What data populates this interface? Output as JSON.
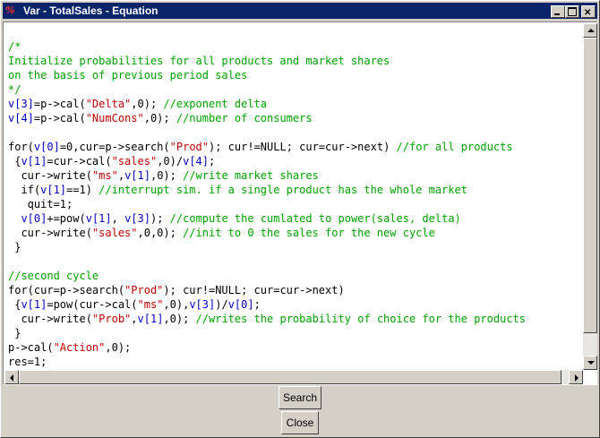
{
  "window": {
    "title": "Var - TotalSales - Equation",
    "icon_text": "%",
    "controls": [
      "minimize-icon",
      "maximize-icon",
      "close-icon"
    ]
  },
  "colors": {
    "titlebar": "#0a246a",
    "comment": "#00a000",
    "variable": "#0000c0",
    "string": "#c00000"
  },
  "editor": {
    "lines": [
      [
        {
          "t": "/*",
          "c": "comment"
        }
      ],
      [
        {
          "t": "Initialize probabilities for all products and market shares",
          "c": "comment"
        }
      ],
      [
        {
          "t": "on the basis of previous period sales",
          "c": "comment"
        }
      ],
      [
        {
          "t": "*/",
          "c": "comment"
        }
      ],
      [
        {
          "t": "v[3]",
          "c": "var"
        },
        {
          "t": "=p->cal(",
          "c": ""
        },
        {
          "t": "\"Delta\"",
          "c": "str"
        },
        {
          "t": ",0); ",
          "c": ""
        },
        {
          "t": "//exponent delta",
          "c": "comment"
        }
      ],
      [
        {
          "t": "v[4]",
          "c": "var"
        },
        {
          "t": "=p->cal(",
          "c": ""
        },
        {
          "t": "\"NumCons\"",
          "c": "str"
        },
        {
          "t": ",0); ",
          "c": ""
        },
        {
          "t": "//number of consumers",
          "c": "comment"
        }
      ],
      [
        {
          "t": "",
          "c": ""
        }
      ],
      [
        {
          "t": "for(",
          "c": ""
        },
        {
          "t": "v[0]",
          "c": "var"
        },
        {
          "t": "=0,cur=p->search(",
          "c": ""
        },
        {
          "t": "\"Prod\"",
          "c": "str"
        },
        {
          "t": "); cur!=NULL; cur=cur->next) ",
          "c": ""
        },
        {
          "t": "//for all products",
          "c": "comment"
        }
      ],
      [
        {
          "t": " {",
          "c": ""
        },
        {
          "t": "v[1]",
          "c": "var"
        },
        {
          "t": "=cur->cal(",
          "c": ""
        },
        {
          "t": "\"sales\"",
          "c": "str"
        },
        {
          "t": ",0)/",
          "c": ""
        },
        {
          "t": "v[4]",
          "c": "var"
        },
        {
          "t": ";",
          "c": ""
        }
      ],
      [
        {
          "t": "  cur->write(",
          "c": ""
        },
        {
          "t": "\"ms\"",
          "c": "str"
        },
        {
          "t": ",",
          "c": ""
        },
        {
          "t": "v[1]",
          "c": "var"
        },
        {
          "t": ",0); ",
          "c": ""
        },
        {
          "t": "//write market shares",
          "c": "comment"
        }
      ],
      [
        {
          "t": "  if(",
          "c": ""
        },
        {
          "t": "v[1]",
          "c": "var"
        },
        {
          "t": "==1) ",
          "c": ""
        },
        {
          "t": "//interrupt sim. if a single product has the whole market",
          "c": "comment"
        }
      ],
      [
        {
          "t": "   quit=1;",
          "c": ""
        }
      ],
      [
        {
          "t": "  ",
          "c": ""
        },
        {
          "t": "v[0]",
          "c": "var"
        },
        {
          "t": "+=pow(",
          "c": ""
        },
        {
          "t": "v[1]",
          "c": "var"
        },
        {
          "t": ", ",
          "c": ""
        },
        {
          "t": "v[3]",
          "c": "var"
        },
        {
          "t": "); ",
          "c": ""
        },
        {
          "t": "//compute the cumlated to power(sales, delta)",
          "c": "comment"
        }
      ],
      [
        {
          "t": "  cur->write(",
          "c": ""
        },
        {
          "t": "\"sales\"",
          "c": "str"
        },
        {
          "t": ",0,0); ",
          "c": ""
        },
        {
          "t": "//init to 0 the sales for the new cycle",
          "c": "comment"
        }
      ],
      [
        {
          "t": " }",
          "c": ""
        }
      ],
      [
        {
          "t": "",
          "c": ""
        }
      ],
      [
        {
          "t": "//second cycle",
          "c": "comment"
        }
      ],
      [
        {
          "t": "for(cur=p->search(",
          "c": ""
        },
        {
          "t": "\"Prod\"",
          "c": "str"
        },
        {
          "t": "); cur!=NULL; cur=cur->next)",
          "c": ""
        }
      ],
      [
        {
          "t": " {",
          "c": ""
        },
        {
          "t": "v[1]",
          "c": "var"
        },
        {
          "t": "=pow(cur->cal(",
          "c": ""
        },
        {
          "t": "\"ms\"",
          "c": "str"
        },
        {
          "t": ",0),",
          "c": ""
        },
        {
          "t": "v[3]",
          "c": "var"
        },
        {
          "t": ")/",
          "c": ""
        },
        {
          "t": "v[0]",
          "c": "var"
        },
        {
          "t": ";",
          "c": ""
        }
      ],
      [
        {
          "t": "  cur->write(",
          "c": ""
        },
        {
          "t": "\"Prob\"",
          "c": "str"
        },
        {
          "t": ",",
          "c": ""
        },
        {
          "t": "v[1]",
          "c": "var"
        },
        {
          "t": ",0); ",
          "c": ""
        },
        {
          "t": "//writes the probability of choice for the products",
          "c": "comment"
        }
      ],
      [
        {
          "t": " }",
          "c": ""
        }
      ],
      [
        {
          "t": "p->cal(",
          "c": ""
        },
        {
          "t": "\"Action\"",
          "c": "str"
        },
        {
          "t": ",0);",
          "c": ""
        }
      ],
      [
        {
          "t": "res=1;",
          "c": ""
        }
      ]
    ]
  },
  "scrollbars": {
    "vertical": [
      "up-arrow-icon",
      "down-arrow-icon"
    ],
    "horizontal": [
      "left-arrow-icon",
      "right-arrow-icon"
    ]
  },
  "buttons": {
    "search": "Search",
    "close": "Close"
  }
}
